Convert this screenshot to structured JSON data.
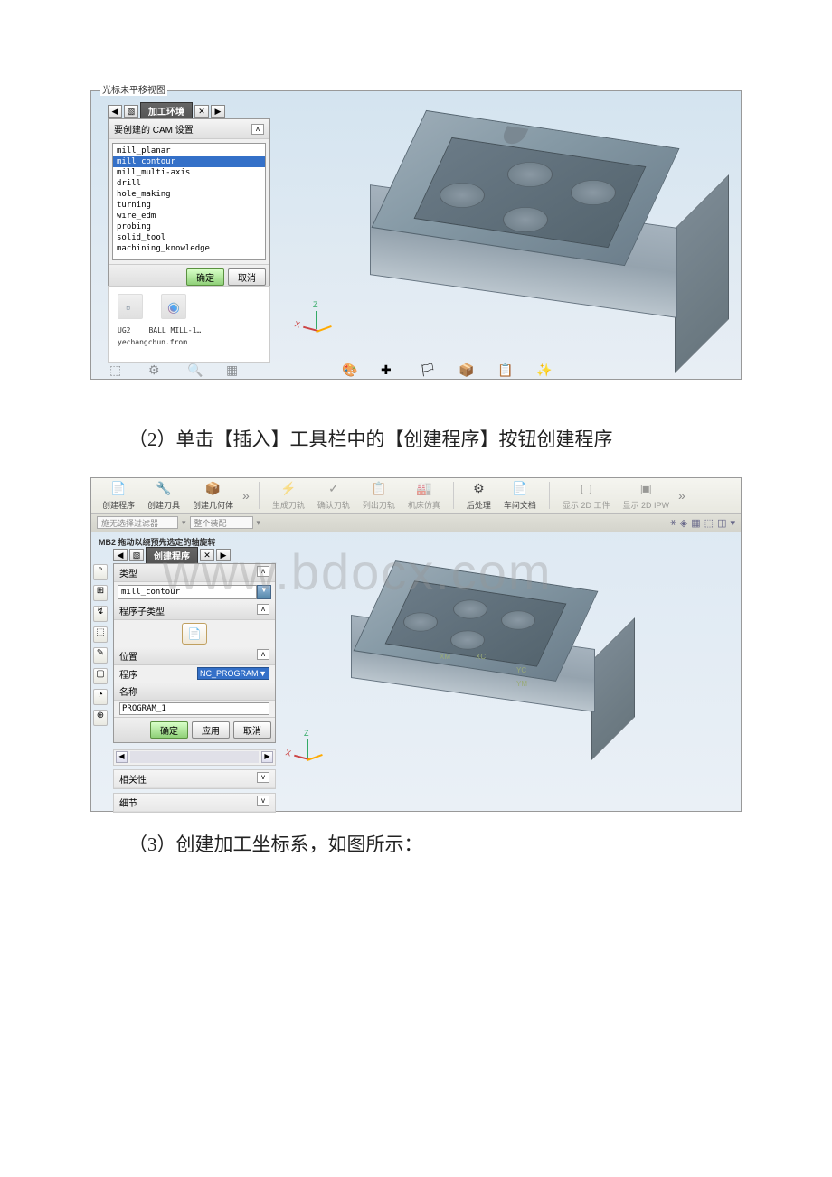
{
  "screenshot1": {
    "window_title": "光标未平移视图",
    "tab_title": "加工环境",
    "dialog_header": "要创建的 CAM 设置",
    "list_items": [
      "mill_planar",
      "mill_contour",
      "mill_multi-axis",
      "drill",
      "hole_making",
      "turning",
      "wire_edm",
      "probing",
      "solid_tool",
      "machining_knowledge"
    ],
    "selected_index": 1,
    "ok_button": "确定",
    "cancel_button": "取消",
    "thumb1_label": "UG2",
    "thumb2_label": "BALL_MILL-1…",
    "thumb_sub": "yechangchun.from"
  },
  "body_text_2": "（2）单击【插入】工具栏中的【创建程序】按钮创建程序",
  "body_text_3": "（3）创建加工坐标系，如图所示：",
  "screenshot2": {
    "toolbar": {
      "btn1": "创建程序",
      "btn2": "创建刀具",
      "btn3": "创建几何体",
      "btn4": "生成刀轨",
      "btn5": "确认刀轨",
      "btn6": "列出刀轨",
      "btn7": "机床仿真",
      "btn8": "后处理",
      "btn9": "车间文档",
      "btn10": "显示 2D 工件",
      "btn11": "显示 2D IPW"
    },
    "subbar_placeholder1": "施无选择过滤器",
    "subbar_placeholder2": "整个装配",
    "hint": "MB2 拖动以绕预先选定的轴旋转",
    "tab_title": "创建程序",
    "section_type": "类型",
    "type_value": "mill_contour",
    "section_subtype": "程序子类型",
    "section_position": "位置",
    "program_label": "程序",
    "program_value": "NC_PROGRAM",
    "section_name": "名称",
    "name_value": "PROGRAM_1",
    "ok_button": "确定",
    "apply_button": "应用",
    "cancel_button": "取消",
    "rel_panel": "相关性",
    "detail_panel": "细节",
    "csys_xm": "XM",
    "csys_xc": "XC",
    "csys_yc": "YC",
    "csys_ym": "YM"
  },
  "watermark": "www.bdocx.com"
}
